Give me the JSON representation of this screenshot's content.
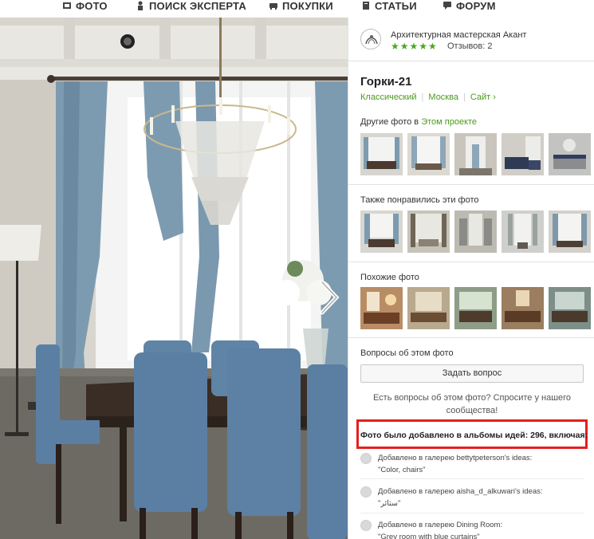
{
  "nav": {
    "items": [
      {
        "label": "ФОТО",
        "icon": "photo-icon"
      },
      {
        "label": "ПОИСК ЭКСПЕРТА",
        "icon": "person-icon"
      },
      {
        "label": "ПОКУПКИ",
        "icon": "cart-icon"
      },
      {
        "label": "СТАТЬИ",
        "icon": "book-icon"
      },
      {
        "label": "ФОРУМ",
        "icon": "chat-icon"
      }
    ]
  },
  "professional": {
    "name": "Архитектурная мастерская Акант",
    "stars": "★★★★★",
    "reviews": "Отзывов: 2"
  },
  "project": {
    "title": "Горки-21",
    "tags": [
      "Классический",
      "Москва",
      "Сайт ›"
    ]
  },
  "sections": {
    "other_photos_prefix": "Другие фото в ",
    "other_photos_link": "Этом проекте",
    "also_liked": "Также понравились эти фото",
    "similar": "Похожие фото",
    "questions": "Вопросы об этом фото"
  },
  "ask": {
    "button": "Задать вопрос",
    "note": "Есть вопросы об этом фото? Спросите у нашего сообщества!"
  },
  "albums": {
    "headline": "Фото было добавлено в альбомы идей: 296, включая:",
    "items": [
      {
        "line1": "Добавлено в галерею bettytpeterson's ideas:",
        "line2": "\"Color, chairs\""
      },
      {
        "line1": "Добавлено в галерею aisha_d_alkuwari's ideas:",
        "line2": "\"ستائر\""
      },
      {
        "line1": "Добавлено в галерею Dining Room:",
        "line2": "\"Grey room with blue curtains\""
      }
    ]
  },
  "colors": {
    "accent_green": "#4a9a1a",
    "highlight_red": "#e4201e",
    "chair_blue": "#5a7fa3"
  }
}
